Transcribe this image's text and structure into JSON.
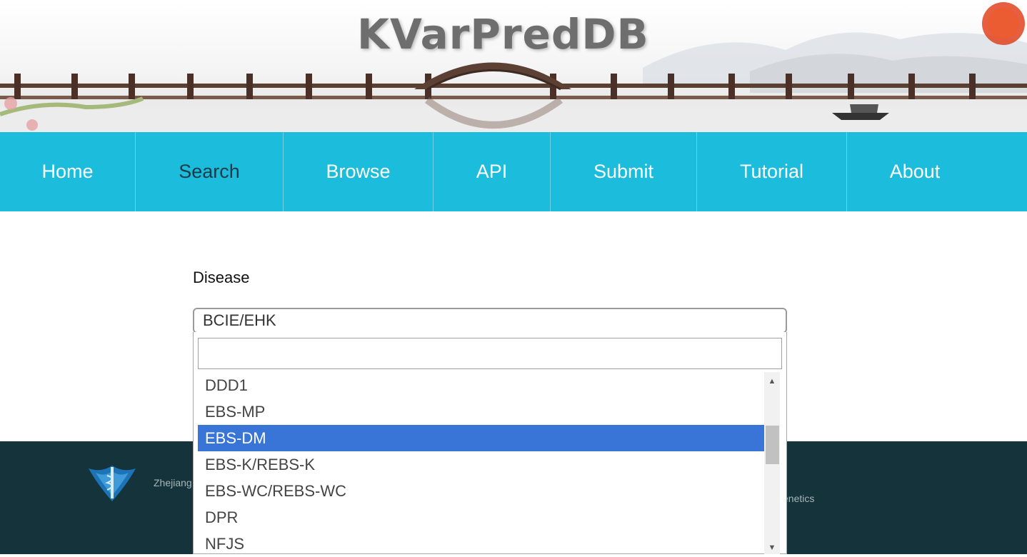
{
  "header": {
    "site_title": "KVarPredDB"
  },
  "nav": {
    "items": [
      {
        "label": "Home"
      },
      {
        "label": "Search"
      },
      {
        "label": "Browse"
      },
      {
        "label": "API"
      },
      {
        "label": "Submit"
      },
      {
        "label": "Tutorial"
      },
      {
        "label": "About"
      }
    ],
    "active": "Search"
  },
  "form": {
    "disease_label": "Disease",
    "disease_value": "BCIE/EHK",
    "search_value": ""
  },
  "dropdown": {
    "options": [
      "DDD1",
      "EBS-MP",
      "EBS-DM",
      "EBS-K/REBS-K",
      "EBS-WC/REBS-WC",
      "DPR",
      "NFJS"
    ],
    "highlighted": "EBS-DM"
  },
  "footer": {
    "left_text": "Zhejiang",
    "right_text": "enetics"
  },
  "colors": {
    "nav_bg": "#1cbcdc",
    "footer_bg": "#14333a",
    "highlight": "#3875d7"
  }
}
